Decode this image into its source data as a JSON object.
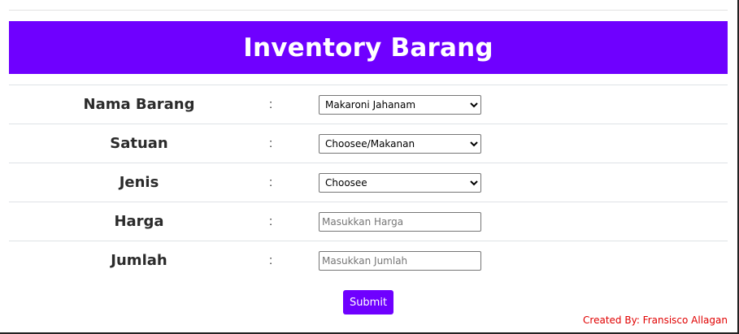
{
  "header": {
    "title": "Inventory Barang"
  },
  "form": {
    "separator": ":",
    "fields": [
      {
        "label": "Nama Barang",
        "type": "select",
        "value": "Makaroni Jahanam"
      },
      {
        "label": "Satuan",
        "type": "select",
        "value": "Choosee/Makanan"
      },
      {
        "label": "Jenis",
        "type": "select",
        "value": "Choosee"
      },
      {
        "label": "Harga",
        "type": "input",
        "placeholder": "Masukkan Harga"
      },
      {
        "label": "Jumlah",
        "type": "input",
        "placeholder": "Masukkan Jumlah"
      }
    ],
    "submit_label": "Submit"
  },
  "footer": {
    "credit": "Created By: Fransisco Allagan"
  },
  "colors": {
    "accent": "#6f00ff",
    "credit": "#e00000"
  }
}
